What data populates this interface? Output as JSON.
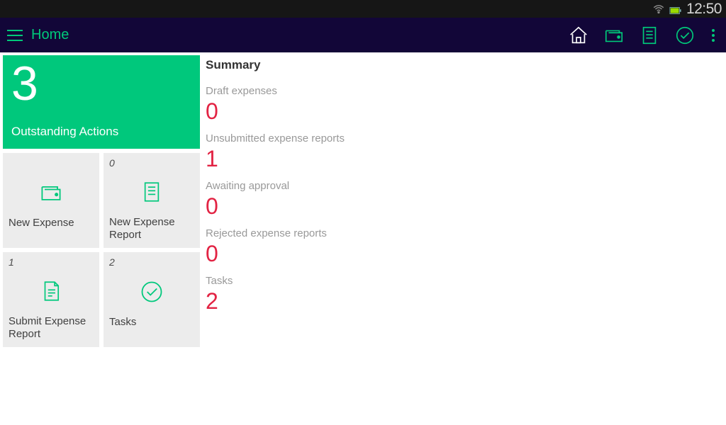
{
  "status": {
    "time": "12:50"
  },
  "hdr": {
    "title": "Home"
  },
  "outstanding": {
    "count": "3",
    "label": "Outstanding Actions"
  },
  "tiles": {
    "newExpense": {
      "label": "New Expense"
    },
    "newReport": {
      "badge": "0",
      "label": "New Expense Report"
    },
    "submit": {
      "badge": "1",
      "label": "Submit Expense Report"
    },
    "tasks": {
      "badge": "2",
      "label": "Tasks"
    }
  },
  "summary": {
    "heading": "Summary",
    "items": [
      {
        "label": "Draft expenses",
        "value": "0"
      },
      {
        "label": "Unsubmitted expense reports",
        "value": "1"
      },
      {
        "label": "Awaiting approval",
        "value": "0"
      },
      {
        "label": "Rejected expense reports",
        "value": "0"
      },
      {
        "label": "Tasks",
        "value": "2"
      }
    ]
  }
}
